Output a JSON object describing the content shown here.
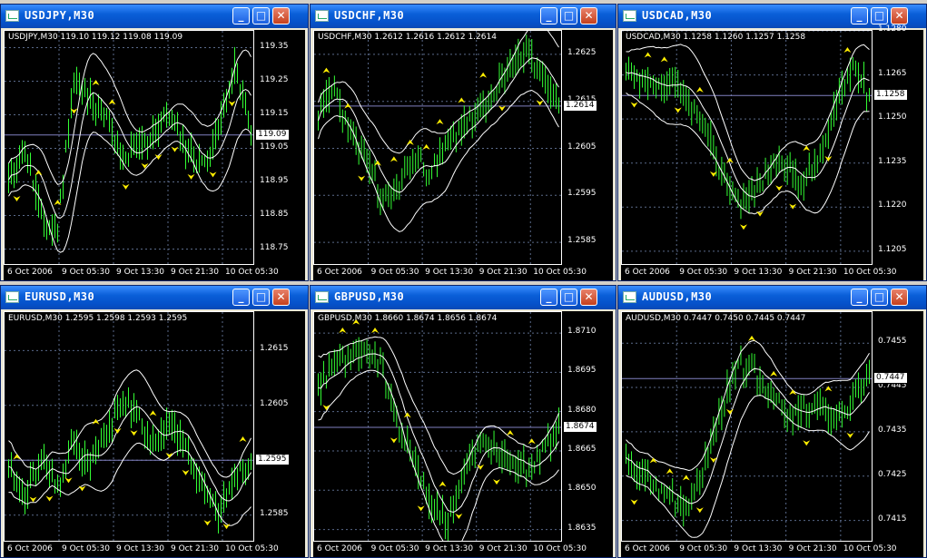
{
  "windows": [
    {
      "id": "usdjpy",
      "title": "USDJPY,M30",
      "info": "USDJPY,M30  119.10 119.12 119.08 119.09",
      "ylim": [
        118.7,
        119.4
      ],
      "yticks": [
        "119.35",
        "119.25",
        "119.15",
        "119.05",
        "118.95",
        "118.85",
        "118.75"
      ],
      "ytick_values": [
        119.35,
        119.25,
        119.15,
        119.05,
        118.95,
        118.85,
        118.75
      ],
      "xticks": [
        "6 Oct 2006",
        "9 Oct 05:30",
        "9 Oct 13:30",
        "9 Oct 21:30",
        "10 Oct 05:30"
      ],
      "current_price": "119.09",
      "current_value": 119.09,
      "seed": 11,
      "path": [
        118.95,
        119.05,
        118.85,
        118.8,
        119.25,
        119.2,
        119.15,
        119.0,
        119.05,
        119.1,
        119.15,
        119.05,
        119.0,
        119.1,
        119.3,
        119.09
      ]
    },
    {
      "id": "usdchf",
      "title": "USDCHF,M30",
      "info": "USDCHF,M30  1.2612 1.2616 1.2612 1.2614",
      "ylim": [
        1.258,
        1.263
      ],
      "yticks": [
        "1.2625",
        "1.2615",
        "1.2605",
        "1.2595",
        "1.2585"
      ],
      "ytick_values": [
        1.2625,
        1.2615,
        1.2605,
        1.2595,
        1.2585
      ],
      "xticks": [
        "6 Oct 2006",
        "9 Oct 05:30",
        "9 Oct 13:30",
        "9 Oct 21:30",
        "10 Oct 05:30"
      ],
      "current_price": "1.2614",
      "current_value": 1.2614,
      "seed": 23,
      "path": [
        1.2612,
        1.2618,
        1.2608,
        1.2602,
        1.2594,
        1.2597,
        1.2603,
        1.26,
        1.2606,
        1.261,
        1.2612,
        1.2617,
        1.2622,
        1.2626,
        1.262,
        1.2614
      ]
    },
    {
      "id": "usdcad",
      "title": "USDCAD,M30",
      "info": "USDCAD,M30  1.1258 1.1260 1.1257 1.1258",
      "ylim": [
        1.12,
        1.128
      ],
      "yticks": [
        "1.1280",
        "1.1265",
        "1.1250",
        "1.1235",
        "1.1220",
        "1.1205"
      ],
      "ytick_values": [
        1.128,
        1.1265,
        1.125,
        1.1235,
        1.122,
        1.1205
      ],
      "xticks": [
        "6 Oct 2006",
        "9 Oct 05:30",
        "9 Oct 13:30",
        "9 Oct 21:30",
        "10 Oct 05:30"
      ],
      "current_price": "1.1258",
      "current_value": 1.1258,
      "seed": 37,
      "path": [
        1.1265,
        1.1262,
        1.126,
        1.1262,
        1.1255,
        1.1245,
        1.123,
        1.1222,
        1.1225,
        1.1235,
        1.1232,
        1.1228,
        1.1238,
        1.1255,
        1.1268,
        1.1258
      ]
    },
    {
      "id": "eurusd",
      "title": "EURUSD,M30",
      "info": "EURUSD,M30  1.2595 1.2598 1.2593 1.2595",
      "ylim": [
        1.258,
        1.2622
      ],
      "yticks": [
        "1.2615",
        "1.2605",
        "1.2595",
        "1.2585"
      ],
      "ytick_values": [
        1.2615,
        1.2605,
        1.2595,
        1.2585
      ],
      "xticks": [
        "6 Oct 2006",
        "9 Oct 05:30",
        "9 Oct 13:30",
        "9 Oct 21:30",
        "10 Oct 05:30"
      ],
      "current_price": "1.2595",
      "current_value": 1.2595,
      "seed": 41,
      "path": [
        1.2593,
        1.2588,
        1.2596,
        1.259,
        1.2598,
        1.2594,
        1.26,
        1.2606,
        1.2603,
        1.2598,
        1.2602,
        1.2597,
        1.259,
        1.2585,
        1.2592,
        1.2595
      ]
    },
    {
      "id": "gbpusd",
      "title": "GBPUSD,M30",
      "info": "GBPUSD,M30  1.8660 1.8674 1.8656 1.8674",
      "ylim": [
        1.863,
        1.8718
      ],
      "yticks": [
        "1.8710",
        "1.8695",
        "1.8680",
        "1.8665",
        "1.8650",
        "1.8635"
      ],
      "ytick_values": [
        1.871,
        1.8695,
        1.868,
        1.8665,
        1.865,
        1.8635
      ],
      "xticks": [
        "6 Oct 2006",
        "9 Oct 05:30",
        "9 Oct 13:30",
        "9 Oct 21:30",
        "10 Oct 05:30"
      ],
      "current_price": "1.8674",
      "current_value": 1.8674,
      "seed": 53,
      "path": [
        1.869,
        1.8698,
        1.8702,
        1.8704,
        1.8698,
        1.8672,
        1.8662,
        1.8645,
        1.8638,
        1.8655,
        1.8668,
        1.8665,
        1.866,
        1.8658,
        1.8665,
        1.8674
      ]
    },
    {
      "id": "audusd",
      "title": "AUDUSD,M30",
      "info": "AUDUSD,M30  0.7447 0.7450 0.7445 0.7447",
      "ylim": [
        0.741,
        0.7462
      ],
      "yticks": [
        "0.7455",
        "0.7445",
        "0.7435",
        "0.7425",
        "0.7415"
      ],
      "ytick_values": [
        0.7455,
        0.7445,
        0.7435,
        0.7425,
        0.7415
      ],
      "xticks": [
        "6 Oct 2006",
        "9 Oct 05:30",
        "9 Oct 13:30",
        "9 Oct 21:30",
        "10 Oct 05:30"
      ],
      "current_price": "0.7447",
      "current_value": 0.7447,
      "seed": 67,
      "path": [
        0.7428,
        0.7425,
        0.7422,
        0.742,
        0.7418,
        0.743,
        0.7442,
        0.745,
        0.7448,
        0.7444,
        0.7438,
        0.744,
        0.7441,
        0.7438,
        0.7442,
        0.7447
      ]
    }
  ],
  "colors": {
    "candle": "#33ff33",
    "band": "#ffffff",
    "fractal": "#ffee00",
    "grid": "#5a6a8a",
    "priceline": "#8080c0"
  },
  "buttons": {
    "minimize": "_",
    "maximize": "□",
    "close": "✕"
  }
}
